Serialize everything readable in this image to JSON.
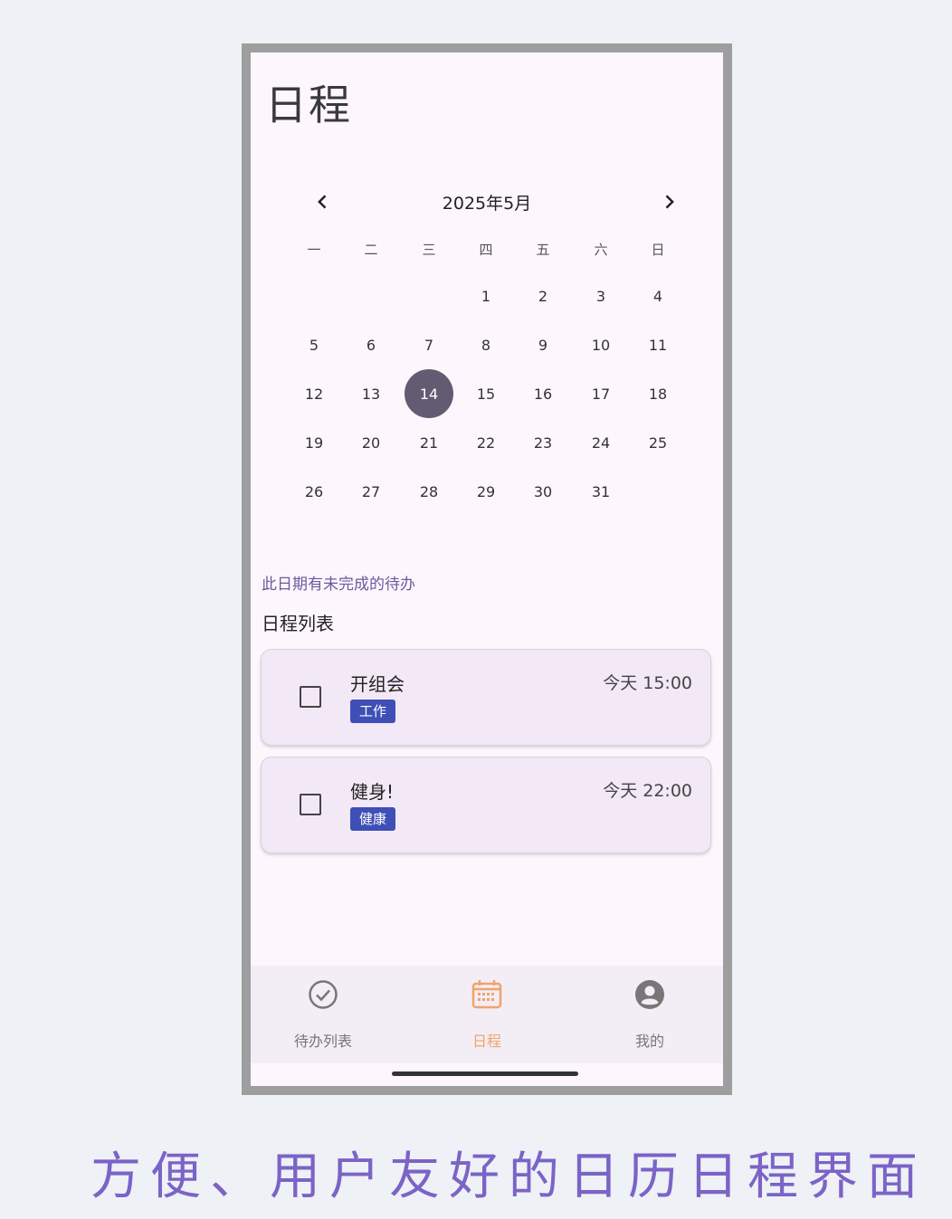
{
  "page_title": "日程",
  "calendar": {
    "month_label": "2025年5月",
    "weekdays": [
      "一",
      "二",
      "三",
      "四",
      "五",
      "六",
      "日"
    ],
    "days": [
      "1",
      "2",
      "3",
      "4",
      "5",
      "6",
      "7",
      "8",
      "9",
      "10",
      "11",
      "12",
      "13",
      "14",
      "15",
      "16",
      "17",
      "18",
      "19",
      "20",
      "21",
      "22",
      "23",
      "24",
      "25",
      "26",
      "27",
      "28",
      "29",
      "30",
      "31"
    ],
    "first_weekday_index": 3,
    "selected_day": "14",
    "prev_icon": "chevron-left-icon",
    "next_icon": "chevron-right-icon"
  },
  "pending_note": "此日期有未完成的待办",
  "list_title": "日程列表",
  "schedules": [
    {
      "title": "开组会",
      "tag": "工作",
      "time": "今天 15:00",
      "checked": false
    },
    {
      "title": "健身!",
      "tag": "健康",
      "time": "今天 22:00",
      "checked": false
    }
  ],
  "bottom_nav": {
    "tabs": [
      {
        "label": "待办列表",
        "icon": "check-circle-icon",
        "active": false
      },
      {
        "label": "日程",
        "icon": "calendar-icon",
        "active": true
      },
      {
        "label": "我的",
        "icon": "account-icon",
        "active": false
      }
    ]
  },
  "caption": "方便、用户友好的日历日程界面",
  "colors": {
    "accent": "#625b71",
    "tag_bg": "#3e4fb5",
    "active_tab": "#f0a46a",
    "caption": "#7b63c7",
    "note": "#6a5a9e"
  }
}
